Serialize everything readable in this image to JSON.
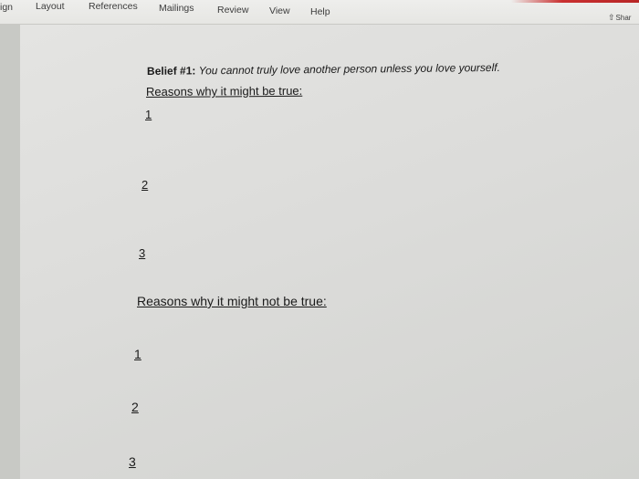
{
  "ribbon": {
    "tabs": [
      "ign",
      "Layout",
      "References",
      "Mailings",
      "Review",
      "View",
      "Help"
    ],
    "share_label": "Shar"
  },
  "document": {
    "belief_label": "Belief #1:",
    "belief_statement": "You cannot truly love another person unless you love yourself.",
    "true_heading": "Reasons why it might be true:",
    "true_items": [
      "1",
      "2",
      "3"
    ],
    "false_heading": "Reasons why it might not be true:",
    "false_items": [
      "1",
      "2",
      "3"
    ]
  },
  "colors": {
    "accent_bar": "#c93030"
  }
}
